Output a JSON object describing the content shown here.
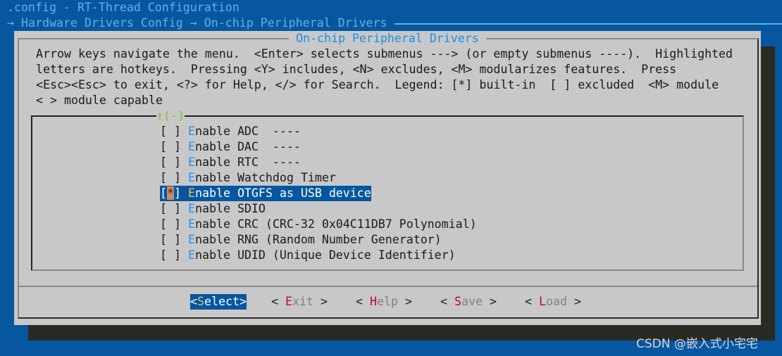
{
  "window_title": ".config - RT-Thread Configuration",
  "breadcrumb": {
    "arrow": "→",
    "items": [
      "Hardware Drivers Config",
      "On-chip Peripheral Drivers"
    ]
  },
  "dialog": {
    "title": "On-chip Peripheral Drivers",
    "help_lines": [
      "Arrow keys navigate the menu.  <Enter> selects submenus ---> (or empty submenus ----).  Highlighted",
      "letters are hotkeys.  Pressing <Y> includes, <N> excludes, <M> modularizes features.  Press",
      "<Esc><Esc> to exit, <?> for Help, </> for Search.  Legend: [*] built-in  [ ] excluded  <M> module",
      "< > module capable"
    ],
    "scroll_indicator": "↑(-)",
    "items": [
      {
        "check": " ",
        "hotkey": "E",
        "rest": "nable ADC  ----",
        "selected": false
      },
      {
        "check": " ",
        "hotkey": "E",
        "rest": "nable DAC  ----",
        "selected": false
      },
      {
        "check": " ",
        "hotkey": "E",
        "rest": "nable RTC  ----",
        "selected": false
      },
      {
        "check": " ",
        "hotkey": "E",
        "rest": "nable Watchdog Timer",
        "selected": false
      },
      {
        "check": "*",
        "hotkey": "E",
        "rest": "nable OTGFS as USB device",
        "selected": true
      },
      {
        "check": " ",
        "hotkey": "E",
        "rest": "nable SDIO",
        "selected": false
      },
      {
        "check": " ",
        "hotkey": "E",
        "rest": "nable CRC (CRC-32 0x04C11DB7 Polynomial)",
        "selected": false
      },
      {
        "check": " ",
        "hotkey": "E",
        "rest": "nable RNG (Random Number Generator)",
        "selected": false
      },
      {
        "check": " ",
        "hotkey": "E",
        "rest": "nable UDID (Unique Device Identifier)",
        "selected": false
      }
    ],
    "buttons": [
      {
        "open": "<",
        "hotkey": "S",
        "rest": "elect",
        "close": ">",
        "active": true
      },
      {
        "open": "< ",
        "hotkey": "E",
        "rest": "xit",
        "close": " >",
        "active": false
      },
      {
        "open": "< ",
        "hotkey": "H",
        "rest": "elp",
        "close": " >",
        "active": false
      },
      {
        "open": "< ",
        "hotkey": "S",
        "rest": "ave",
        "close": " >",
        "active": false
      },
      {
        "open": "< ",
        "hotkey": "L",
        "rest": "oad",
        "close": " >",
        "active": false
      }
    ]
  },
  "watermark": "CSDN @嵌入式小宅宅"
}
